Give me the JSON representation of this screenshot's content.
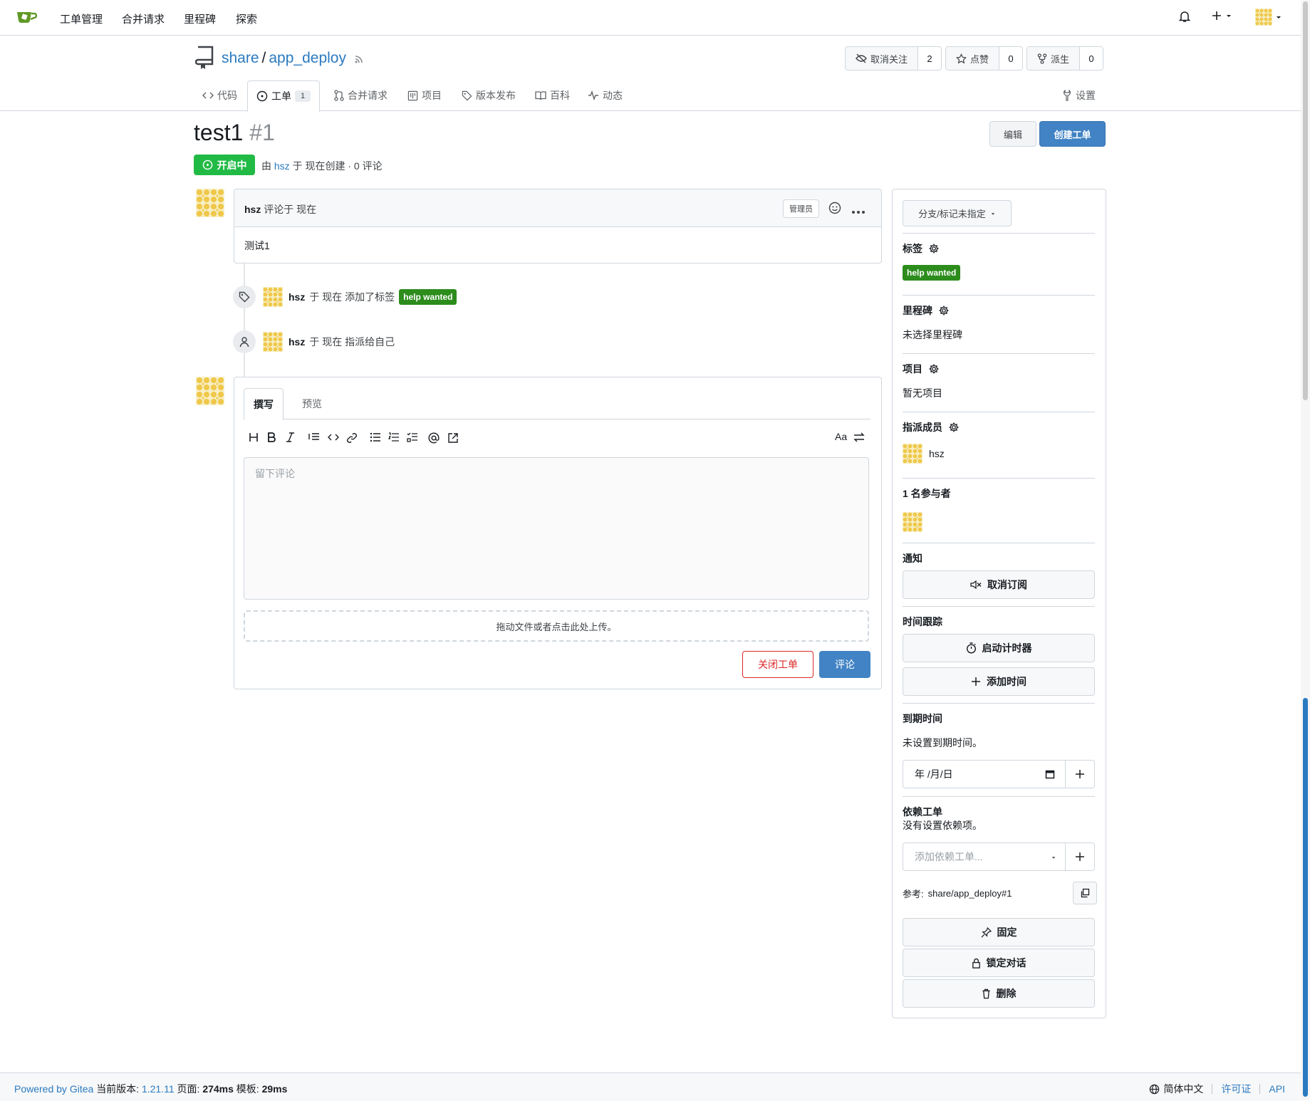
{
  "nav": {
    "items": [
      "工单管理",
      "合并请求",
      "里程碑",
      "探索"
    ]
  },
  "repo": {
    "owner": "share",
    "separator": "/",
    "name": "app_deploy",
    "unwatch_label": "取消关注",
    "watch_count": "2",
    "star_label": "点赞",
    "star_count": "0",
    "fork_label": "派生",
    "fork_count": "0",
    "tabs": {
      "code": "代码",
      "issues": "工单",
      "issues_count": "1",
      "pulls": "合并请求",
      "projects": "项目",
      "releases": "版本发布",
      "wiki": "百科",
      "activity": "动态",
      "settings": "设置"
    }
  },
  "issue": {
    "title": "test1",
    "number": "#1",
    "edit_label": "编辑",
    "new_issue_label": "创建工单",
    "status": "开启中",
    "meta_prefix": "由",
    "meta_author": "hsz",
    "meta_suffix": "于 现在创建 · 0 评论"
  },
  "comment": {
    "author": "hsz",
    "time_text": "评论于 现在",
    "role": "管理员",
    "body": "测试1"
  },
  "events": [
    {
      "author": "hsz",
      "text": "于 现在 添加了标签",
      "label": "help wanted"
    },
    {
      "author": "hsz",
      "text": "于 现在 指派给自己"
    }
  ],
  "editor": {
    "tab_write": "撰写",
    "tab_preview": "预览",
    "font_toggle": "Aa",
    "placeholder": "留下评论",
    "dropzone": "拖动文件或者点击此处上传。",
    "close_label": "关闭工单",
    "comment_label": "评论"
  },
  "sidebar": {
    "branch": "分支/标记未指定",
    "labels_head": "标签",
    "label": "help wanted",
    "milestone_head": "里程碑",
    "milestone_value": "未选择里程碑",
    "projects_head": "项目",
    "projects_value": "暂无项目",
    "assignees_head": "指派成员",
    "assignee": "hsz",
    "participants_head": "1 名参与者",
    "notify_head": "通知",
    "unsubscribe": "取消订阅",
    "time_head": "时间跟踪",
    "start_timer": "启动计时器",
    "add_time": "添加时间",
    "due_head": "到期时间",
    "due_value": "未设置到期时间。",
    "date_placeholder": "年 /月/日",
    "deps_head": "依赖工单",
    "deps_value": "没有设置依赖项。",
    "deps_placeholder": "添加依赖工单...",
    "ref_label": "参考:",
    "ref_value": "share/app_deploy#1",
    "pin": "固定",
    "lock": "锁定对话",
    "delete": "删除"
  },
  "footer": {
    "powered": "Powered by Gitea",
    "version_label": "当前版本:",
    "version": "1.21.11",
    "page_label": "页面:",
    "page_time": "274ms",
    "tmpl_label": "模板:",
    "tmpl_time": "29ms",
    "language": "简体中文",
    "license": "许可证",
    "api": "API"
  },
  "colors": {
    "accent": "#4183c4",
    "open_green": "#21ba45",
    "label_green": "#2c8c1c",
    "danger": "#db2828"
  }
}
